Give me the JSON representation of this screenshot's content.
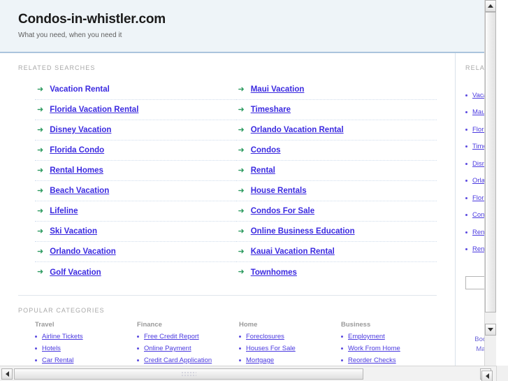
{
  "header": {
    "title": "Condos-in-whistler.com",
    "tagline": "What you need, when you need it"
  },
  "main": {
    "related_searches_label": "RELATED SEARCHES",
    "popular_categories_label": "POPULAR CATEGORIES",
    "related_searches_col1": [
      "Vacation Rental",
      "Florida Vacation Rental",
      "Disney Vacation",
      "Florida Condo",
      "Rental Homes",
      "Beach Vacation",
      "Lifeline",
      "Ski Vacation",
      "Orlando Vacation",
      "Golf Vacation"
    ],
    "related_searches_col2": [
      "Maui Vacation",
      "Timeshare",
      "Orlando Vacation Rental",
      "Condos",
      "Rental",
      "House Rentals",
      "Condos For Sale",
      "Online Business Education",
      "Kauai Vacation Rental",
      "Townhomes"
    ],
    "categories": [
      {
        "title": "Travel",
        "items": [
          "Airline Tickets",
          "Hotels",
          "Car Rental"
        ]
      },
      {
        "title": "Finance",
        "items": [
          "Free Credit Report",
          "Online Payment",
          "Credit Card Application"
        ]
      },
      {
        "title": "Home",
        "items": [
          "Foreclosures",
          "Houses For Sale",
          "Mortgage"
        ]
      },
      {
        "title": "Business",
        "items": [
          "Employment",
          "Work From Home",
          "Reorder Checks"
        ]
      }
    ]
  },
  "sidebar": {
    "label": "RELATED",
    "items": [
      "Vacation Rental",
      "Maui Vacation",
      "Florida Vacation Rental",
      "Timeshare",
      "Disney Vacation",
      "Orlando Vacation Rental",
      "Florida Condo",
      "Condos",
      "Rental Homes",
      "Rental"
    ],
    "search_value": "",
    "search_placeholder": "",
    "bookmark_label": "Bookmark",
    "homepage_label": "Make this"
  },
  "colors": {
    "link": "#3b2ae0",
    "arrow_bullet": "#2a9a5e",
    "header_bg": "#eef4f8",
    "header_border": "#aac4dd"
  }
}
